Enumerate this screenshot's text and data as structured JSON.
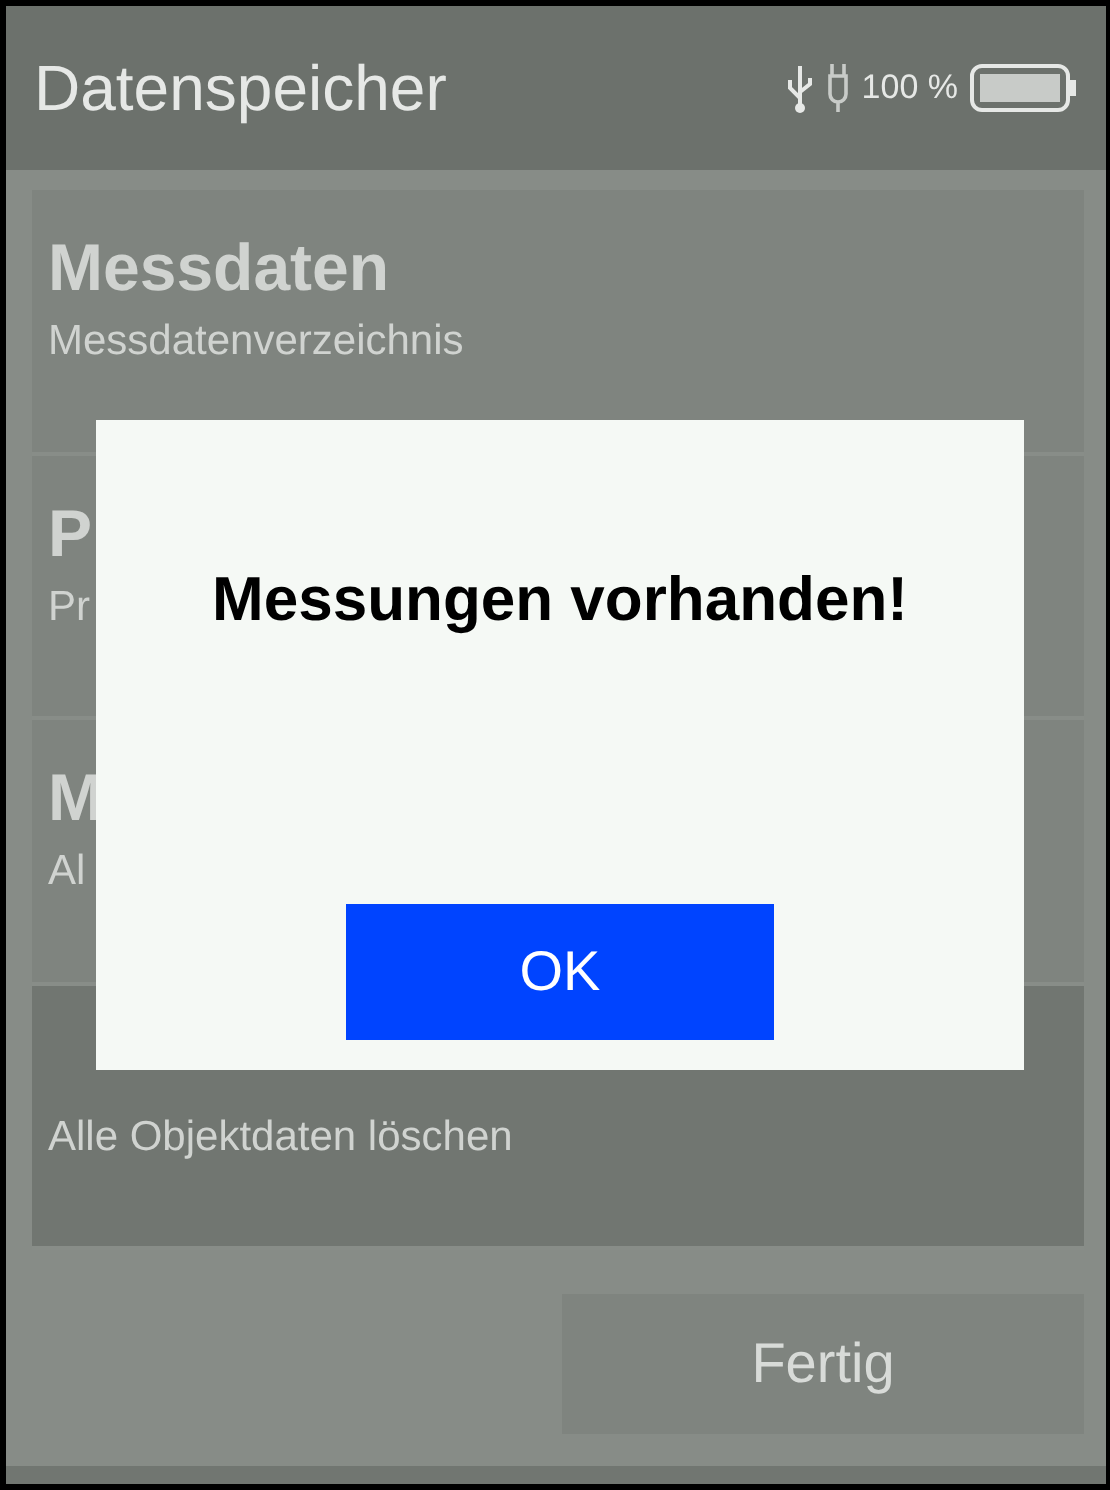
{
  "header": {
    "title": "Datenspeicher",
    "battery_text": "100 %"
  },
  "items": [
    {
      "title": "Messdaten",
      "subtitle": "Messdatenverzeichnis",
      "selected": false
    },
    {
      "title": "P",
      "subtitle": "Pr",
      "selected": false
    },
    {
      "title": "M",
      "subtitle": "Al",
      "selected": false
    },
    {
      "subtitle": "Alle Objektdaten löschen",
      "selected": true
    }
  ],
  "done_button": "Fertig",
  "dialog": {
    "message": "Messungen vorhanden!",
    "button": "OK"
  }
}
